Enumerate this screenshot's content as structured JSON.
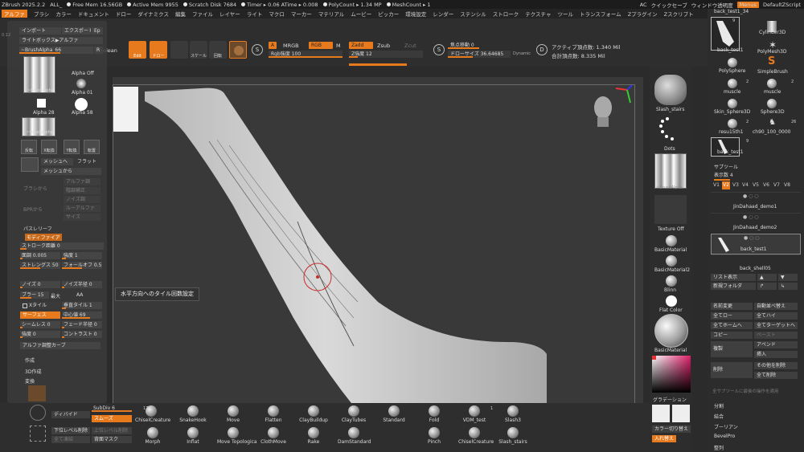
{
  "titlebar": {
    "app": "ZBrush 2025.2.2",
    "doc": "ALL_",
    "free_mem": "Free Mem 16.56GB",
    "active_mem": "Active Mem 9955",
    "scratch": "Scratch Disk 7684",
    "timer": "Timer ▸ 0.06 ATime ▸ 0.008",
    "polycount": "PolyCount ▸ 1.34 MP",
    "meshcount": "MeshCount ▸ 1",
    "ac": "AC",
    "quicksave": "クイックセーブ",
    "window_transparency": "ウィンドウ透明度",
    "menus": "Menus",
    "script": "DefaultZScript"
  },
  "menubar": [
    "アルファ",
    "ブラシ",
    "カラー",
    "ドキュメント",
    "ドロー",
    "ダイナミクス",
    "編集",
    "ファイル",
    "レイヤー",
    "ライト",
    "マクロ",
    "マーカー",
    "マテリアル",
    "ムービー",
    "ピッカー",
    "環境設定",
    "レンダー",
    "ステンシル",
    "ストローク",
    "テクスチャ",
    "ツール",
    "トランスフォーム",
    "Zプラグイン",
    "Zスクリプト"
  ],
  "toolbar": {
    "edit": "Edit",
    "move": "ドロー",
    "scale": "スケール",
    "rotate": "回転",
    "a": "A",
    "mrgb": "MRGB",
    "rgb": "RGB",
    "m": "M",
    "rgb_intensity": "Rgb強度 100",
    "zadd": "Zadd",
    "zsub": "Zsub",
    "zcut": "Zcut",
    "z_intensity": "Z強度 12",
    "focal_shift": "焦点移動 0",
    "draw_size": "ドローサイズ 36.64685",
    "dynamic": "Dynamic",
    "active_points": "アクティブ頂点数: 1.340 Mil",
    "total_points": "合計頂点数: 8.335 Mil",
    "coords": "0.12",
    "lightbox": "olean"
  },
  "left": {
    "import": "インポート",
    "export": "エクスポート",
    "ep": "Ep",
    "lightbox": "ライトボックス▶アルファ",
    "brush_alpha": "~BrushAlpha_66",
    "r": "R",
    "alpha_off": "Alpha Off",
    "alpha01": "Alpha 01",
    "brush_alpha_label": "~BrushAlpha",
    "alpha28": "Alpha 28",
    "alpha58": "Alpha 58",
    "brush_alpha2": "~BrushAlpha",
    "icons": [
      "反転",
      "X転換",
      "Y転換",
      "転置"
    ],
    "mesh_to": "メッシュへ",
    "flat": "フラット",
    "from_mesh": "メッシュから",
    "from_brush": "ブラシから",
    "alpha_adjust": "アルファ調",
    "layer_adjust": "階調補正",
    "noise": "ノイズ調",
    "alpha_ops": "ルーアルファ",
    "size_hint": "サイズ",
    "from_bpr": "BPRから",
    "pasreef": "パスレリーフ",
    "modifiers": "モディファイア",
    "stroke_interval": "ストローク距離 0",
    "blur_adjust": "面調 0.005",
    "strength": "強度 1",
    "strength50": "ストレングス 50",
    "falloff": "フォールオフ 0.5",
    "noise_adj": "ノイズ 0",
    "noise_radius": "ノイズ半径 0",
    "blur": "ブラー 15",
    "max": "最大",
    "aa": "AA",
    "tile": "Xタイル",
    "tile_check": "垂直タイル 1",
    "surface": "サーフェス",
    "mid_value": "中心値 69",
    "seamless": "シームレス 0",
    "fade": "フェード半径 0",
    "strength0": "強度 0",
    "contrast": "コントラスト 0",
    "alpha_curve": "アルファ調整カーブ",
    "create": "作成",
    "create3d": "3D作成",
    "convert": "変換"
  },
  "tooltip": "水平方向へのタイル回数設定",
  "mats": {
    "slash_stairs": "Slash_stairs",
    "dots": "Dots",
    "brush_alpha": "~BrushAlpha",
    "texture_off": "Texture Off",
    "basic": "BasicMaterial",
    "basic2": "BasicMaterial2",
    "blinn": "Blinn",
    "flat": "Flat Color",
    "basic_sel": "BasicMaterial",
    "gradation": "グラデーション",
    "color_swap": "カラー切り替え",
    "swap": "入れ替え"
  },
  "toolpanel": {
    "top_label": "back_test1_34",
    "tools": [
      {
        "name": "back_test1",
        "num": "9"
      },
      {
        "name": "Cylinder3D",
        "num": ""
      },
      {
        "name": "PolySphere",
        "num": ""
      },
      {
        "name": "PolyMesh3D",
        "num": ""
      },
      {
        "name": "muscle",
        "num": "2"
      },
      {
        "name": "SimpleBrush",
        "num": ""
      },
      {
        "name": "Skin_Sphere3D",
        "num": ""
      },
      {
        "name": "muscle",
        "num": "2"
      },
      {
        "name": "resu15th1",
        "num": "2"
      },
      {
        "name": "Sphere3D",
        "num": ""
      },
      {
        "name": "ch90_100_0000",
        "num": "26"
      },
      {
        "name": "back_test1",
        "num": "9"
      }
    ],
    "subtool_header": "サブツール",
    "visible_count": "表示数 4",
    "versions": [
      "V1",
      "V2",
      "V3",
      "V4",
      "V5",
      "V6",
      "V7",
      "V8"
    ],
    "subtools": [
      "JinDahaad_demo1",
      "JinDahaad_demo2",
      "back_test1",
      "back_shell05"
    ],
    "list_all": "リスト表示",
    "new_folder": "新規フォルダ",
    "rename": "名前変更",
    "auto_reorder": "自動並べ替え",
    "all_low": "全てロー",
    "all_high": "全てハイ",
    "all_home": "全てホームへ",
    "all_target": "全てターゲットへ",
    "copy": "コピー",
    "paste": "ペースト",
    "duplicate": "複製",
    "append": "アペンド",
    "insert": "挿入",
    "delete": "削除",
    "delete_other": "その他を削除",
    "delete_all": "全て削除",
    "apply_all": "全サブツールに最後の操作を適用",
    "split": "分割",
    "merge": "結合",
    "boolean": "ブーリアン",
    "bevelpro": "BevelPro",
    "remesh": "整列"
  },
  "bottom": {
    "divide": "ディバイド",
    "subdiv": "SubDiv 6",
    "smooth": "スムーズ",
    "lower_del": "下位レベル削除",
    "higher_del": "上位レベル削除",
    "freeze_all": "全て凍結",
    "back_mask": "背面マスク",
    "brushes_row1": [
      "ChiselCreature",
      "SnakeHook",
      "Move",
      "Flatten",
      "ClayBuildup",
      "ClayTubes",
      "Standard",
      "Fold",
      "VDM_test",
      "Slash3"
    ],
    "brushes_row2": [
      "Morph",
      "Inflat",
      "Move Topologica",
      "ClothMove",
      "Rake",
      "DamStandard",
      "",
      "Pinch",
      "ChiselCreature",
      "Slash_stairs"
    ],
    "nums": {
      "chisel": "17",
      "vdm": "1"
    }
  },
  "colors": {
    "accent": "#e87a1e",
    "canvas": "#393939",
    "panel": "#2c2c2c"
  }
}
